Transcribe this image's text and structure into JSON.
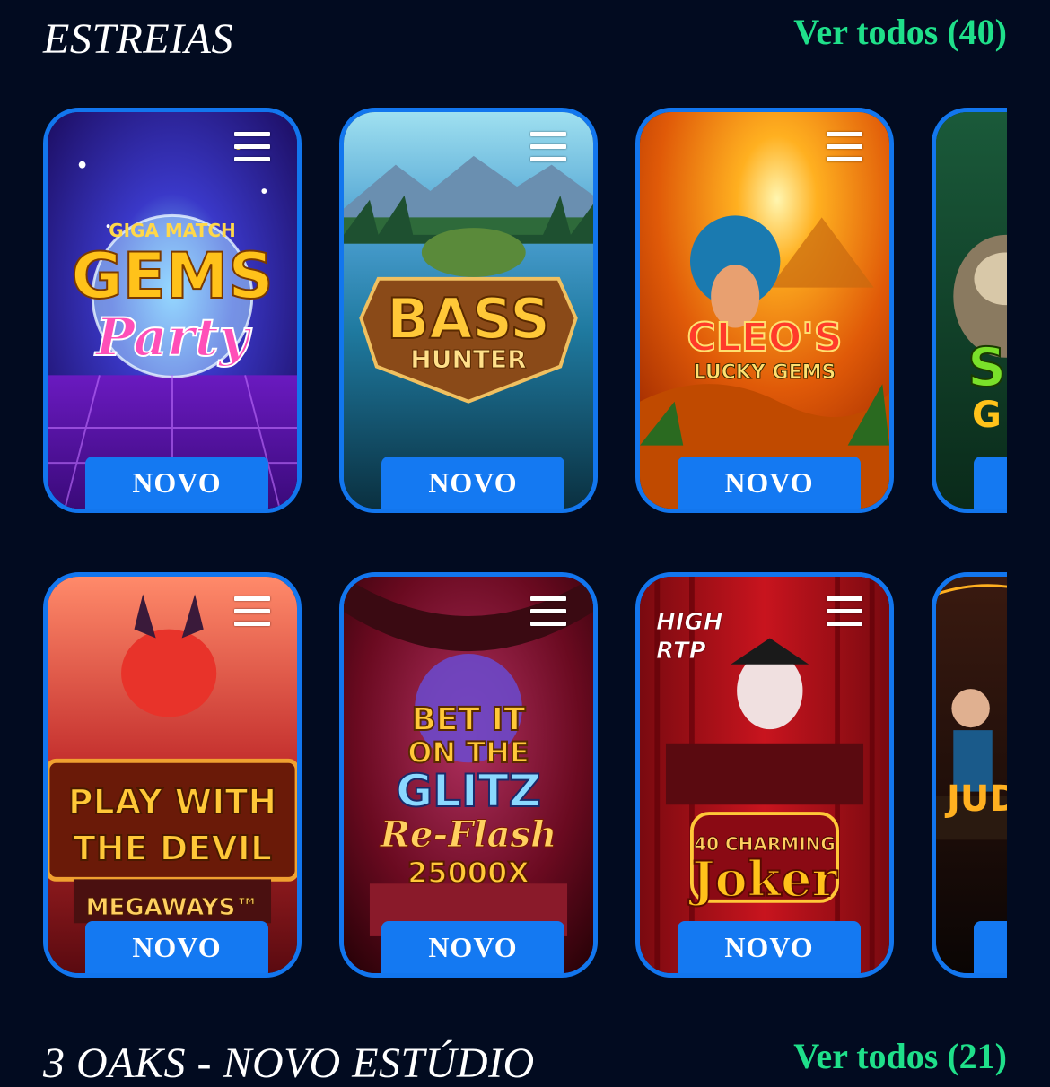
{
  "sections": [
    {
      "title": "ESTREIAS",
      "see_all": "Ver todos (40)",
      "rows": [
        [
          {
            "title_lines": [
              "GIGA MATCH",
              "GEMS",
              "Party"
            ],
            "badge": "NOVO",
            "theme": "gems"
          },
          {
            "title_lines": [
              "BASS",
              "HUNTER"
            ],
            "badge": "NOVO",
            "theme": "bass"
          },
          {
            "title_lines": [
              "CLEO'S",
              "LUCKY GEMS"
            ],
            "badge": "NOVO",
            "theme": "cleo"
          },
          {
            "title_lines": [
              "S",
              "G"
            ],
            "badge": "",
            "theme": "sloth"
          }
        ],
        [
          {
            "title_lines": [
              "PLAY WITH",
              "THE DEVIL",
              "MEGAWAYS™"
            ],
            "badge": "NOVO",
            "theme": "devil"
          },
          {
            "title_lines": [
              "BET IT",
              "ON THE",
              "GLITZ",
              "Re-Flash",
              "25000X"
            ],
            "badge": "NOVO",
            "theme": "glitz"
          },
          {
            "title_lines": [
              "HIGH",
              "RTP",
              "40 CHARMING",
              "Joker"
            ],
            "badge": "NOVO",
            "theme": "joker"
          },
          {
            "title_lines": [
              "JUD"
            ],
            "badge": "",
            "theme": "judge"
          }
        ]
      ]
    },
    {
      "title": "3 OAKS - NOVO ESTÚDIO",
      "see_all": "Ver todos (21)"
    }
  ],
  "colors": {
    "background": "#020b20",
    "accent_green": "#1fe08a",
    "badge_blue": "#1479f2",
    "card_border": "#1276ee"
  },
  "icons": {
    "card_menu": "menu-icon"
  }
}
